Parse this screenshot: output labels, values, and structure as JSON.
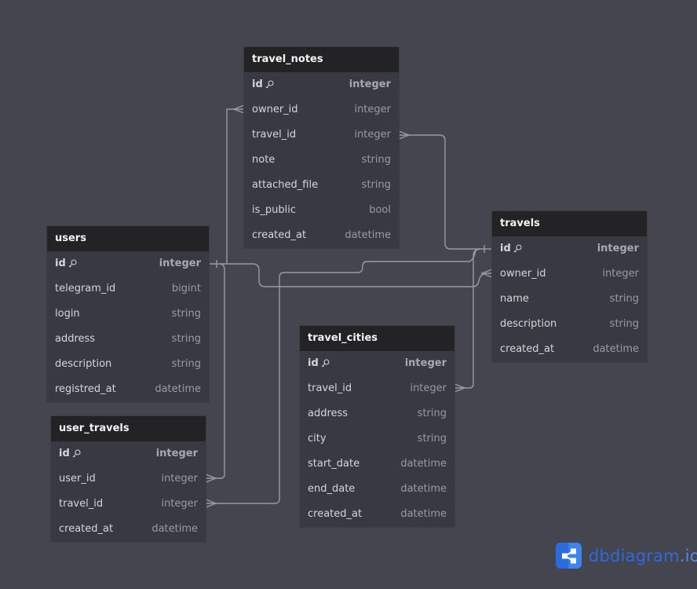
{
  "tables": [
    {
      "name": "travel_notes",
      "fields": [
        {
          "name": "id",
          "type": "integer",
          "pk": true
        },
        {
          "name": "owner_id",
          "type": "integer"
        },
        {
          "name": "travel_id",
          "type": "integer"
        },
        {
          "name": "note",
          "type": "string"
        },
        {
          "name": "attached_file",
          "type": "string"
        },
        {
          "name": "is_public",
          "type": "bool"
        },
        {
          "name": "created_at",
          "type": "datetime"
        }
      ]
    },
    {
      "name": "users",
      "fields": [
        {
          "name": "id",
          "type": "integer",
          "pk": true
        },
        {
          "name": "telegram_id",
          "type": "bigint"
        },
        {
          "name": "login",
          "type": "string"
        },
        {
          "name": "address",
          "type": "string"
        },
        {
          "name": "description",
          "type": "string"
        },
        {
          "name": "registred_at",
          "type": "datetime"
        }
      ]
    },
    {
      "name": "travels",
      "fields": [
        {
          "name": "id",
          "type": "integer",
          "pk": true
        },
        {
          "name": "owner_id",
          "type": "integer"
        },
        {
          "name": "name",
          "type": "string"
        },
        {
          "name": "description",
          "type": "string"
        },
        {
          "name": "created_at",
          "type": "datetime"
        }
      ]
    },
    {
      "name": "travel_cities",
      "fields": [
        {
          "name": "id",
          "type": "integer",
          "pk": true
        },
        {
          "name": "travel_id",
          "type": "integer"
        },
        {
          "name": "address",
          "type": "string"
        },
        {
          "name": "city",
          "type": "string"
        },
        {
          "name": "start_date",
          "type": "datetime"
        },
        {
          "name": "end_date",
          "type": "datetime"
        },
        {
          "name": "created_at",
          "type": "datetime"
        }
      ]
    },
    {
      "name": "user_travels",
      "fields": [
        {
          "name": "id",
          "type": "integer",
          "pk": true
        },
        {
          "name": "user_id",
          "type": "integer"
        },
        {
          "name": "travel_id",
          "type": "integer"
        },
        {
          "name": "created_at",
          "type": "datetime"
        }
      ]
    }
  ],
  "relationships": [
    {
      "from": "travel_notes.owner_id",
      "to": "users.id",
      "type": "many-to-one"
    },
    {
      "from": "travel_notes.travel_id",
      "to": "travels.id",
      "type": "many-to-one"
    },
    {
      "from": "travels.owner_id",
      "to": "users.id",
      "type": "many-to-one"
    },
    {
      "from": "travel_cities.travel_id",
      "to": "travels.id",
      "type": "many-to-one"
    },
    {
      "from": "user_travels.user_id",
      "to": "users.id",
      "type": "many-to-one"
    },
    {
      "from": "user_travels.travel_id",
      "to": "travels.id",
      "type": "many-to-one"
    }
  ],
  "logo": {
    "name": "dbdiagram",
    "tld": ".io",
    "icon": "share-nodes-icon"
  },
  "colors": {
    "background": "#45454f",
    "table_header": "#232325",
    "table_body": "#393942",
    "connector": "#9a9aa3",
    "brand": "#2a6ce0"
  }
}
